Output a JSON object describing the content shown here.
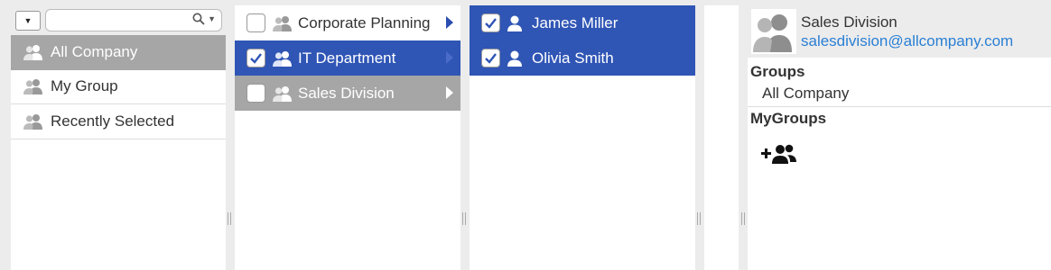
{
  "left_panel": {
    "search": {
      "placeholder": ""
    },
    "items": [
      {
        "label": "All Company",
        "selected": true
      },
      {
        "label": "My Group",
        "selected": false
      },
      {
        "label": "Recently Selected",
        "selected": false
      }
    ]
  },
  "groups_panel": {
    "items": [
      {
        "label": "Corporate Planning",
        "checked": false,
        "state": "normal"
      },
      {
        "label": "IT Department",
        "checked": true,
        "state": "highlighted"
      },
      {
        "label": "Sales Division",
        "checked": false,
        "state": "selected"
      }
    ]
  },
  "users_panel": {
    "items": [
      {
        "label": "James Miller",
        "checked": true
      },
      {
        "label": "Olivia Smith",
        "checked": true
      }
    ]
  },
  "detail_panel": {
    "name": "Sales Division",
    "email": "salesdivision@allcompany.com",
    "groups_heading": "Groups",
    "groups_value": "All Company",
    "mygroups_heading": "MyGroups"
  },
  "colors": {
    "highlight_blue": "#2f55b5",
    "selected_gray": "#a6a6a6",
    "link_blue": "#2a7fd4"
  },
  "icons": [
    "dropdown-icon",
    "search-icon",
    "group-icon",
    "user-icon",
    "arrow-right-icon",
    "add-group-icon",
    "checkmark-icon"
  ]
}
